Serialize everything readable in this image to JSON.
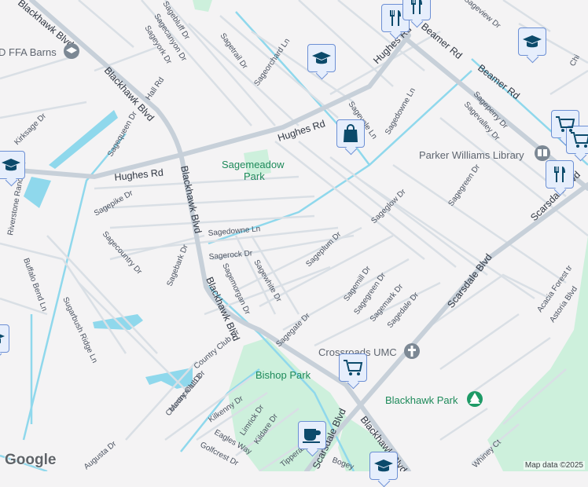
{
  "map": {
    "major_roads": [
      "Blackhawk Blvd",
      "Hughes Rd",
      "Beamer Rd",
      "Scarsdale Blvd",
      "Riverstone Ranch Rd",
      "Country Club Dr"
    ],
    "streets": [
      "Sagebluff Dr",
      "Sagecanyon Dr",
      "Sageyork Dr",
      "Sagetrail Dr",
      "Sageorchard Ln",
      "Hall Rd",
      "Sagequeen Dr",
      "Kirksage Dr",
      "Sagepike Dr",
      "Sagedowne Ln",
      "Sagecountry Dr",
      "Sagebark Dr",
      "Sagerock Dr",
      "Sagemorgan Dr",
      "Sagewhite Dr",
      "Sageplum Dr",
      "Sagegate Dr",
      "Sagevale Ln",
      "Sagedowne Ln",
      "Sageglow Dr",
      "Sagegreen Dr",
      "Sageperry Dr",
      "Sagevalley Dr",
      "Sageview Dr",
      "Sagemill Dr",
      "Sagegreen Dr",
      "Sagemark Dr",
      "Sagedale Dr",
      "Acacia Forest tr",
      "Astoria Blvd",
      "Buffalo Bend Ln",
      "Sugarbush Ridge Ln",
      "Mooncrest Dr",
      "Kilkenny Dr",
      "Limrick Dr",
      "Eagles Way",
      "Kildare Dr",
      "Golfcrest Dr",
      "Tipperary",
      "Augusta Dr",
      "Bogey",
      "Whiney Ct",
      "Chi"
    ],
    "parks": [
      "Sagemeadow Park",
      "Bishop Park",
      "Blackhawk Park"
    ],
    "pois": [
      "D FFA Barns",
      "Parker Williams Library",
      "Crossroads UMC"
    ],
    "attribution": "Map data ©2025",
    "logo": "Google"
  },
  "colors": {
    "water": "#8fd8ec",
    "park": "#cdf0dc",
    "road": "#d4dbe2",
    "pin_bg": "#e6eefc",
    "pin_icon": "#0b4a6b"
  },
  "pins": [
    "restaurant-icon",
    "restaurant-icon",
    "restaurant-icon",
    "school-icon",
    "school-icon",
    "school-icon",
    "school-icon",
    "school-icon",
    "shopping-bag-icon",
    "shopping-cart-icon",
    "shopping-cart-icon",
    "shopping-cart-icon",
    "coffee-icon"
  ]
}
